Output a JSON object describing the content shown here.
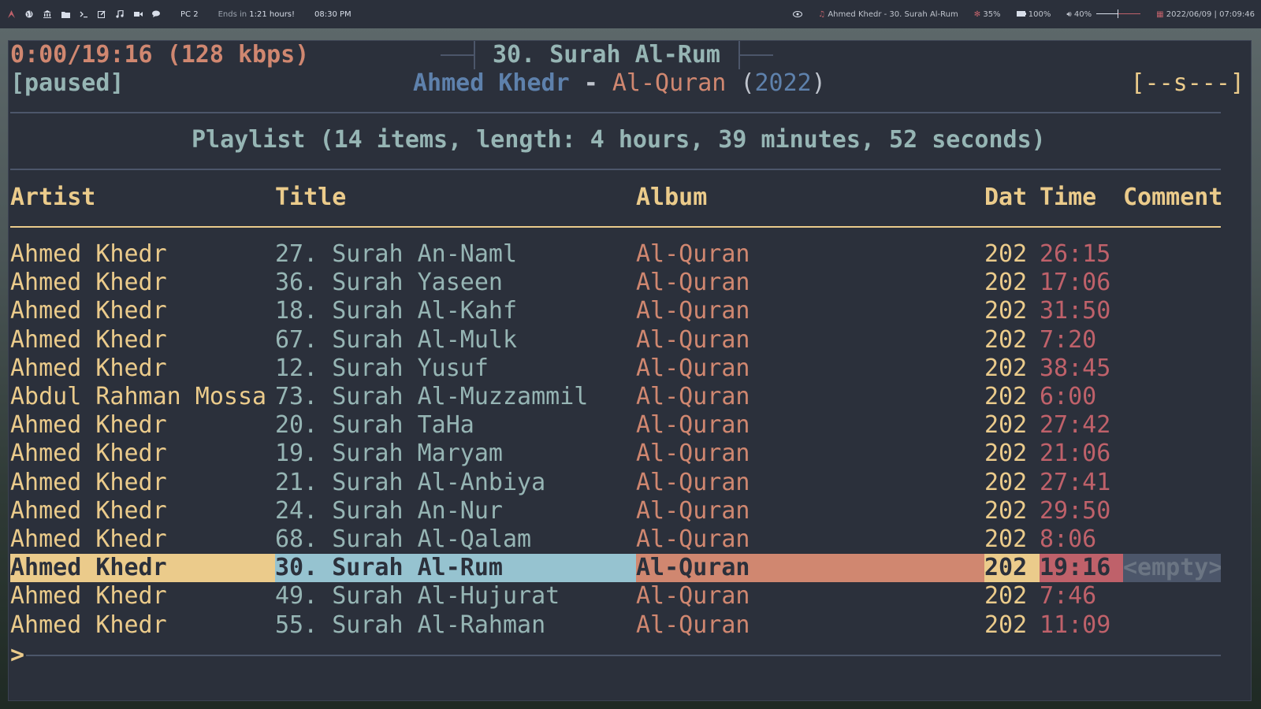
{
  "topbar": {
    "workspace": "PC 2",
    "ends_label": "Ends in",
    "ends_value": "1:21 hours!",
    "clock": "08:30 PM",
    "now_playing": "Ahmed Khedr - 30. Surah Al-Rum",
    "cpu": "35%",
    "battery": "100%",
    "volume": "40%",
    "volume_level": 0.5,
    "datetime": "2022/06/09 | 07:09:46"
  },
  "player": {
    "progress": "0:00/19:16 (128 kbps)",
    "state": "[paused]",
    "track_title": "30. Surah Al-Rum",
    "artist": "Ahmed Khedr",
    "separator": "-",
    "album": "Al-Quran",
    "year": "2022",
    "flags": "[--s---]"
  },
  "playlist": {
    "summary": "Playlist (14 items, length: 4 hours, 39 minutes, 52 seconds)",
    "columns": {
      "artist": "Artist",
      "title": "Title",
      "album": "Album",
      "date": "Dat",
      "time": "Time",
      "comment": "Comment"
    },
    "rows": [
      {
        "artist": "Ahmed Khedr",
        "title": "27. Surah An-Naml",
        "album": "Al-Quran",
        "date": "202",
        "time": "26:15",
        "comment": ""
      },
      {
        "artist": "Ahmed Khedr",
        "title": "36. Surah Yaseen",
        "album": "Al-Quran",
        "date": "202",
        "time": "17:06",
        "comment": ""
      },
      {
        "artist": "Ahmed Khedr",
        "title": "18. Surah Al-Kahf",
        "album": "Al-Quran",
        "date": "202",
        "time": "31:50",
        "comment": ""
      },
      {
        "artist": "Ahmed Khedr",
        "title": "67. Surah Al-Mulk",
        "album": "Al-Quran",
        "date": "202",
        "time": "7:20",
        "comment": ""
      },
      {
        "artist": "Ahmed Khedr",
        "title": "12. Surah Yusuf",
        "album": "Al-Quran",
        "date": "202",
        "time": "38:45",
        "comment": ""
      },
      {
        "artist": "Abdul Rahman Mossa",
        "title": "73. Surah Al-Muzzammil",
        "album": "Al-Quran",
        "date": "202",
        "time": "6:00",
        "comment": ""
      },
      {
        "artist": "Ahmed Khedr",
        "title": "20. Surah TaHa",
        "album": "Al-Quran",
        "date": "202",
        "time": "27:42",
        "comment": ""
      },
      {
        "artist": "Ahmed Khedr",
        "title": "19. Surah Maryam",
        "album": "Al-Quran",
        "date": "202",
        "time": "21:06",
        "comment": ""
      },
      {
        "artist": "Ahmed Khedr",
        "title": "21. Surah Al-Anbiya",
        "album": "Al-Quran",
        "date": "202",
        "time": "27:41",
        "comment": ""
      },
      {
        "artist": "Ahmed Khedr",
        "title": "24. Surah An-Nur",
        "album": "Al-Quran",
        "date": "202",
        "time": "29:50",
        "comment": ""
      },
      {
        "artist": "Ahmed Khedr",
        "title": "68. Surah Al-Qalam",
        "album": "Al-Quran",
        "date": "202",
        "time": "8:06",
        "comment": ""
      },
      {
        "artist": "Ahmed Khedr",
        "title": "30. Surah Al-Rum",
        "album": "Al-Quran",
        "date": "202",
        "time": "19:16",
        "comment": "<empty>",
        "selected": true
      },
      {
        "artist": "Ahmed Khedr",
        "title": "49. Surah Al-Hujurat",
        "album": "Al-Quran",
        "date": "202",
        "time": "7:46",
        "comment": ""
      },
      {
        "artist": "Ahmed Khedr",
        "title": "55. Surah Al-Rahman",
        "album": "Al-Quran",
        "date": "202",
        "time": "11:09",
        "comment": ""
      }
    ]
  },
  "prompt": ">",
  "colors": {
    "background": "#2b303b",
    "artist": "#ebcb8b",
    "title": "#96b5b4",
    "album": "#d08770",
    "time": "#bf616a",
    "accent_blue": "#5e81ac"
  },
  "icons": [
    "arch-icon",
    "globe-icon",
    "bank-icon",
    "folder-icon",
    "terminal-icon",
    "edit-icon",
    "music-icon",
    "video-icon",
    "chat-icon",
    "eye-icon",
    "music-note-icon",
    "fan-icon",
    "battery-icon",
    "volume-icon",
    "calendar-icon"
  ]
}
